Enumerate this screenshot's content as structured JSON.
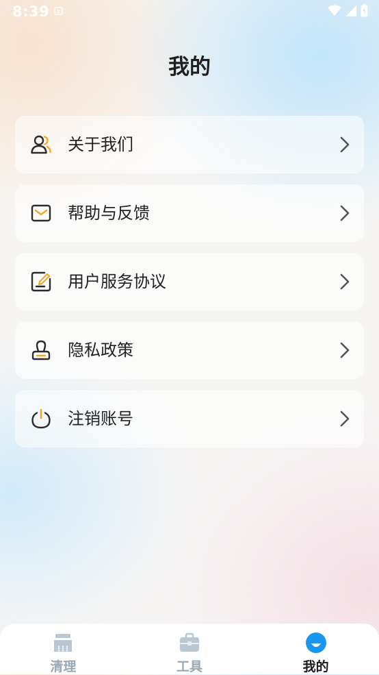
{
  "status_bar": {
    "time": "8:39"
  },
  "header": {
    "title": "我的"
  },
  "menu": {
    "items": [
      {
        "label": "关于我们",
        "icon": "users-icon"
      },
      {
        "label": "帮助与反馈",
        "icon": "mail-icon"
      },
      {
        "label": "用户服务协议",
        "icon": "edit-document-icon"
      },
      {
        "label": "隐私政策",
        "icon": "stamp-icon"
      },
      {
        "label": "注销账号",
        "icon": "power-icon"
      }
    ]
  },
  "tab_bar": {
    "tabs": [
      {
        "label": "清理",
        "icon": "broom-icon",
        "active": false
      },
      {
        "label": "工具",
        "icon": "toolbox-icon",
        "active": false
      },
      {
        "label": "我的",
        "icon": "smile-icon",
        "active": true
      }
    ]
  },
  "colors": {
    "accent_orange": "#f5a623",
    "icon_dark": "#2b2b2b",
    "tab_active_blue": "#1a96f0",
    "tab_inactive": "#b9c7d2"
  }
}
